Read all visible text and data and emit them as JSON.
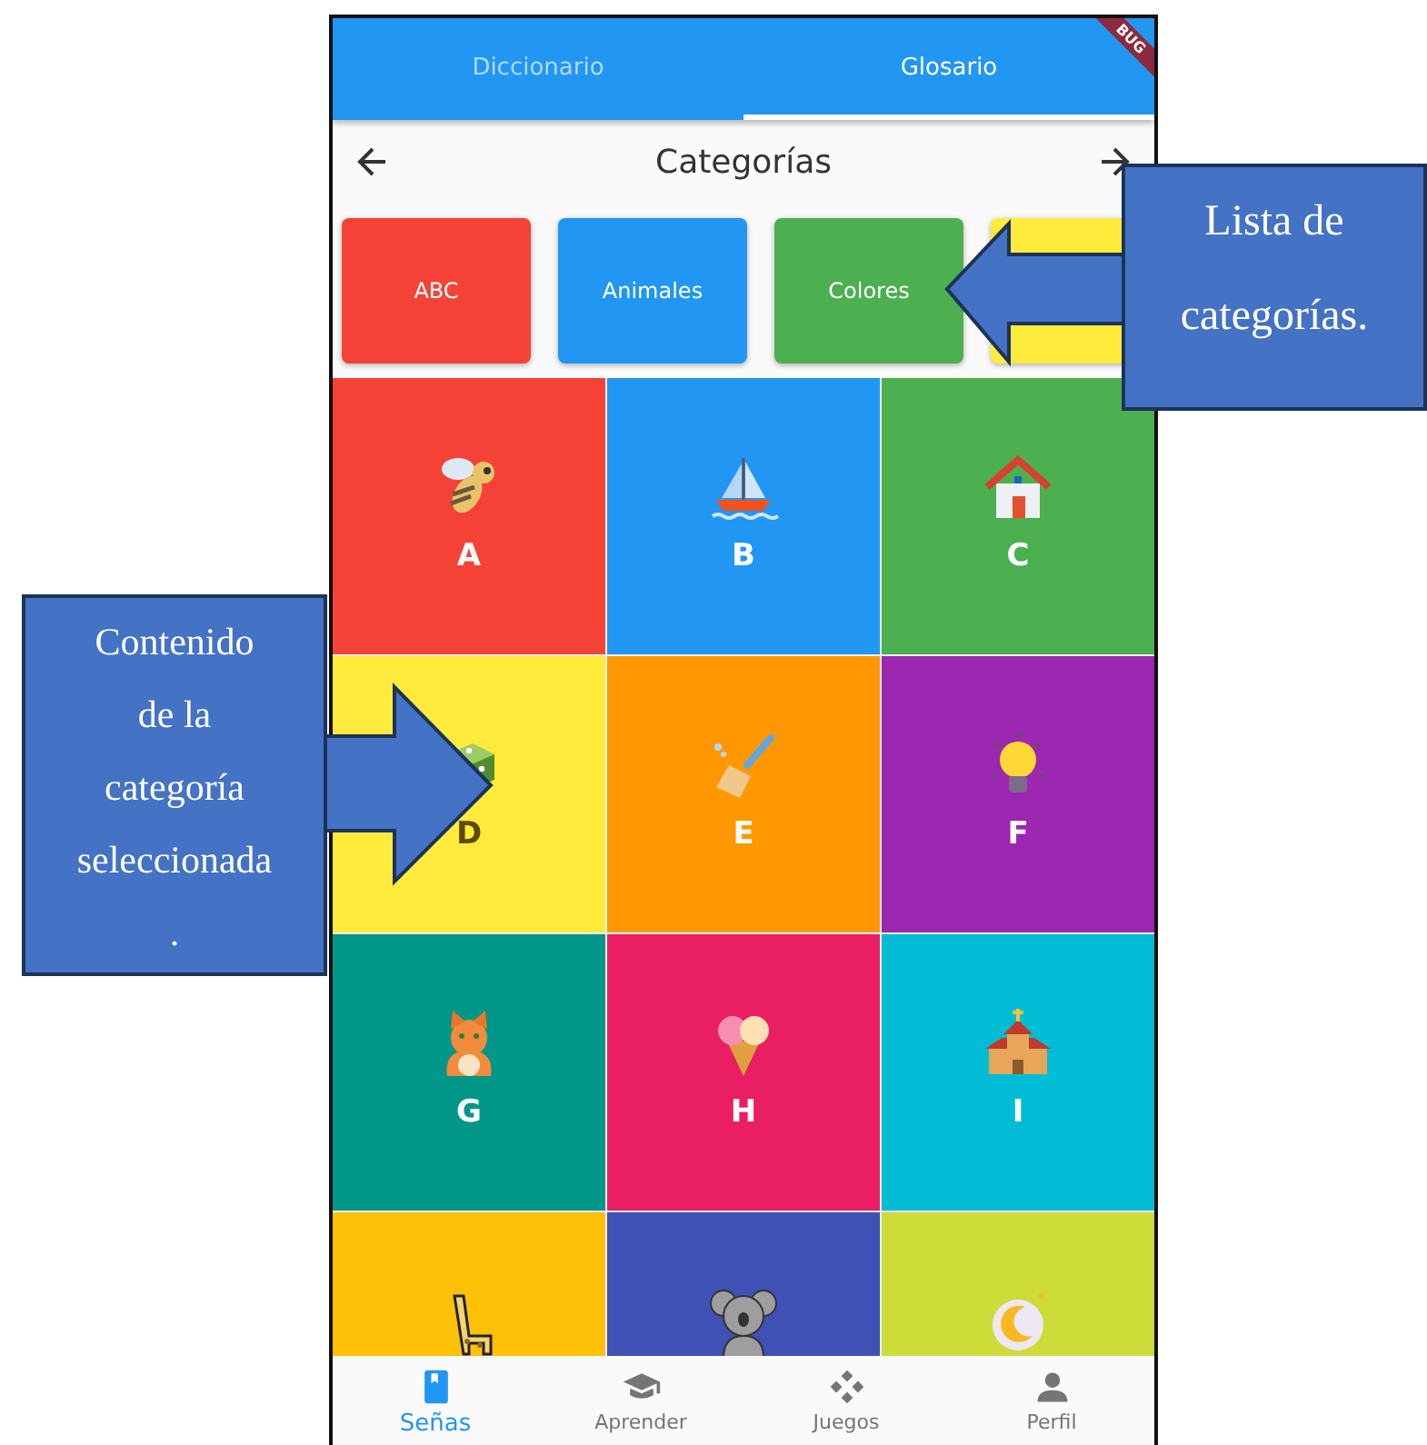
{
  "tabs": [
    {
      "label": "Diccionario",
      "selected": false
    },
    {
      "label": "Glosario",
      "selected": true
    }
  ],
  "debug_banner": "BUG",
  "header": {
    "title": "Categorías"
  },
  "categories": [
    {
      "label": "ABC",
      "color": "#f44336"
    },
    {
      "label": "Animales",
      "color": "#2196f3"
    },
    {
      "label": "Colores",
      "color": "#4caf50"
    },
    {
      "color": "#ffeb3b"
    }
  ],
  "grid": [
    {
      "letter": "A",
      "color": "#f44336"
    },
    {
      "letter": "B",
      "color": "#2196f3"
    },
    {
      "letter": "C",
      "color": "#4caf50"
    },
    {
      "letter": "D",
      "color": "#ffeb3b"
    },
    {
      "letter": "E",
      "color": "#ff9800"
    },
    {
      "letter": "F",
      "color": "#9c27b0"
    },
    {
      "letter": "G",
      "color": "#009688"
    },
    {
      "letter": "H",
      "color": "#e91e63"
    },
    {
      "letter": "I",
      "color": "#00bcd4"
    },
    {
      "color": "#ffc107"
    },
    {
      "color": "#3f51b5"
    },
    {
      "color": "#cddc39"
    }
  ],
  "bottom_nav": [
    {
      "label": "Señas",
      "selected": true
    },
    {
      "label": "Aprender",
      "selected": false
    },
    {
      "label": "Juegos",
      "selected": false
    },
    {
      "label": "Perfil",
      "selected": false
    }
  ],
  "callouts": [
    {
      "text": "Lista de\ncategorías."
    },
    {
      "text": "Contenido\nde la\ncategoría\nseleccionada\n."
    }
  ]
}
